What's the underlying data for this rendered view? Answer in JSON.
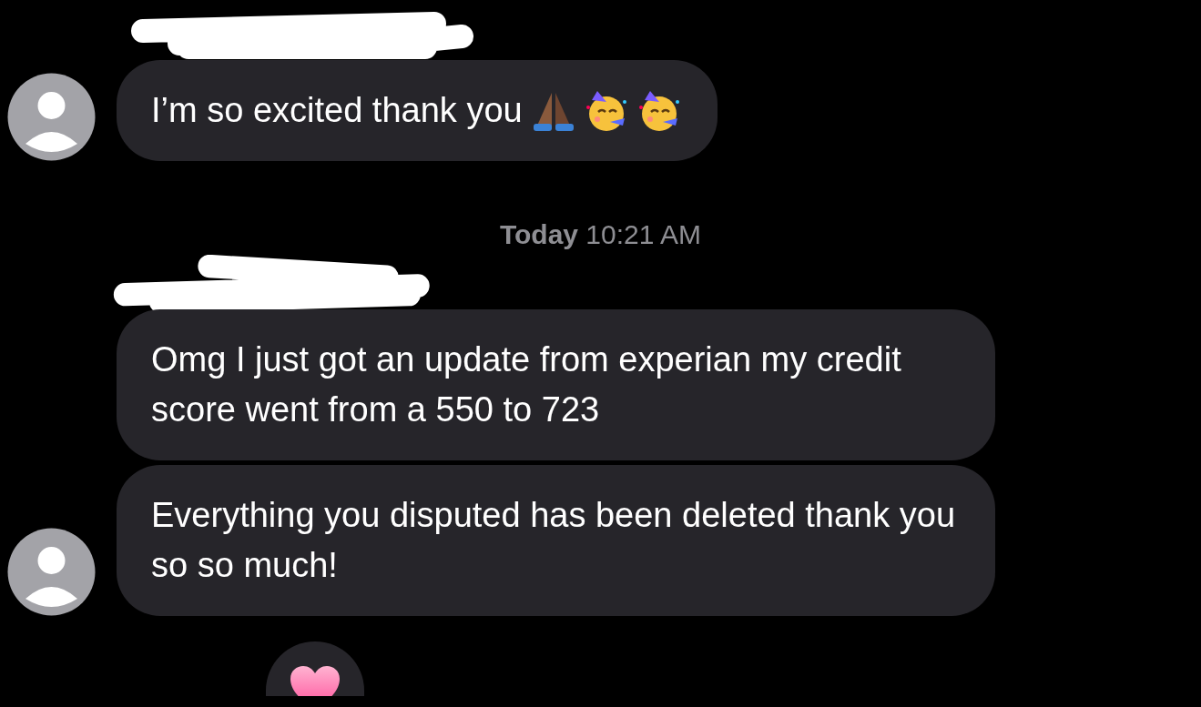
{
  "messages_before": [
    {
      "text": "I’m so excited thank you",
      "emoji": [
        {
          "kind": "pray"
        },
        {
          "kind": "party"
        },
        {
          "kind": "party"
        }
      ],
      "avatar": true,
      "redacted_sender": true
    }
  ],
  "timestamp": "**Today** 10:21 AM",
  "messages_after": [
    {
      "text": "Omg I just got an update from experian my credit score went from a 550 to 723",
      "avatar": false,
      "redacted_sender": true
    },
    {
      "text": "Everything you disputed has been deleted thank you so so much!",
      "avatar": true,
      "redacted_sender": false
    }
  ],
  "reaction": {
    "kind": "heart"
  }
}
